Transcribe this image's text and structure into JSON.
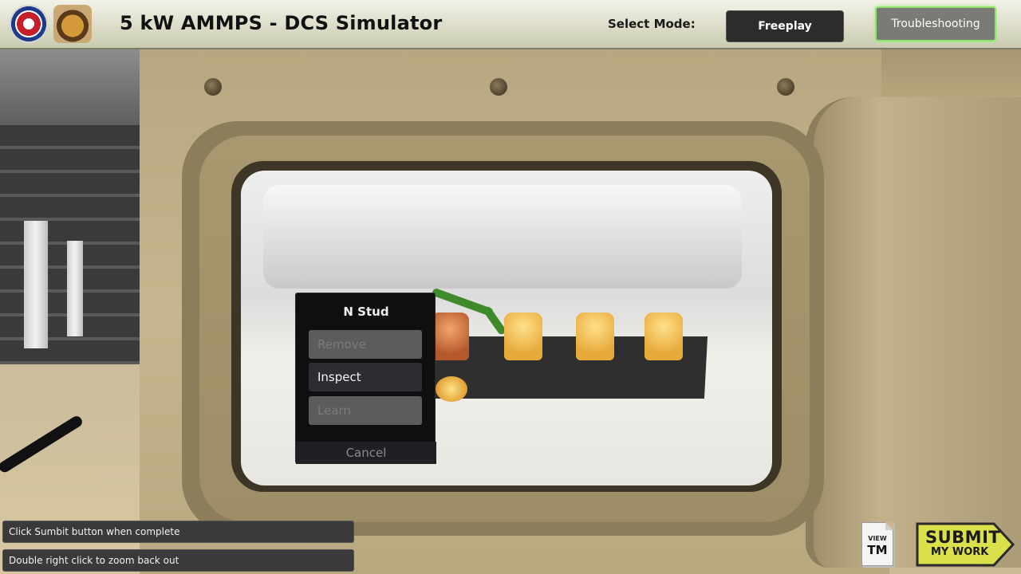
{
  "header": {
    "title": "5 kW AMMPS - DCS Simulator",
    "mode_label": "Select Mode:",
    "modes": [
      {
        "label": "Freeplay",
        "selected": false
      },
      {
        "label": "Troubleshooting",
        "selected": true
      }
    ],
    "logos": [
      "org-seal-logo",
      "unit-crest-logo"
    ]
  },
  "context_menu": {
    "title": "N Stud",
    "items": [
      {
        "label": "Remove",
        "enabled": false
      },
      {
        "label": "Inspect",
        "enabled": true
      },
      {
        "label": "Learn",
        "enabled": false
      }
    ],
    "cancel_label": "Cancel"
  },
  "messages": [
    "Click Sumbit button when complete",
    "Double right click to zoom back out"
  ],
  "view_tm": {
    "line1": "VIEW",
    "line2": "TM"
  },
  "submit": {
    "line1": "SUBMIT",
    "line2": "MY WORK",
    "color": "#d9e04a"
  },
  "colors": {
    "accent_selected": "#8fe36a",
    "menu_bg": "#0f0f12",
    "disabled_btn": "#5c5c5e"
  }
}
